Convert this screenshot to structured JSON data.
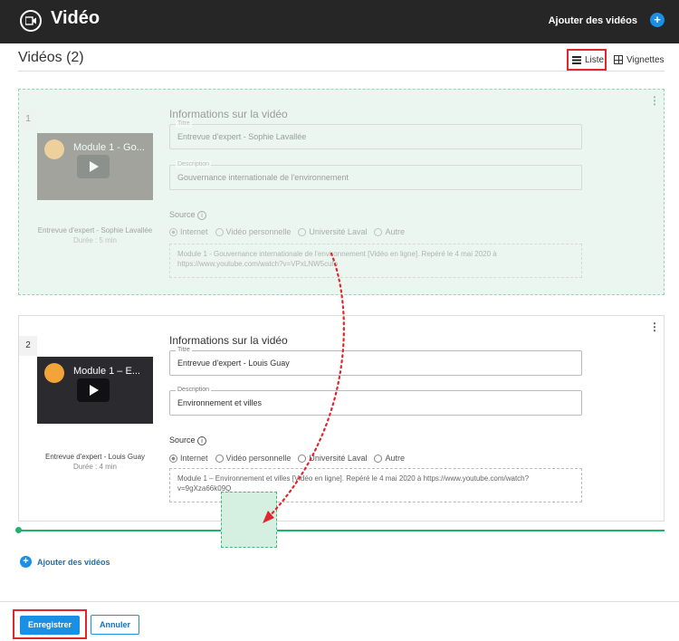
{
  "header": {
    "title": "Vidéo",
    "add_label": "Ajouter des vidéos"
  },
  "page": {
    "heading": "Vidéos (2)",
    "view_list": "Liste",
    "view_thumbs": "Vignettes"
  },
  "videos": [
    {
      "number": "1",
      "thumb_title": "Module 1 - Go...",
      "caption": "Entrevue d'expert - Sophie Lavallée",
      "duration": "Durée : 5 min",
      "info_heading": "Informations sur la vidéo",
      "title_label": "Titre",
      "title_value": "Entrevue d'expert - Sophie Lavallée",
      "desc_label": "Description",
      "desc_value": "Gouvernance internationale de l'environnement",
      "source_label": "Source",
      "sources": [
        "Internet",
        "Vidéo personnelle",
        "Université Laval",
        "Autre"
      ],
      "reference": "Module 1 - Gouvernance internationale de l'environnement [Vidéo en ligne]. Repéré le 4 mai 2020 à https://www.youtube.com/watch?v=VPxLNW5cufo"
    },
    {
      "number": "2",
      "thumb_title": "Module 1 – E...",
      "caption": "Entrevue d'expert - Louis Guay",
      "duration": "Durée : 4 min",
      "info_heading": "Informations sur la vidéo",
      "title_label": "Titre",
      "title_value": "Entrevue d'expert - Louis Guay",
      "desc_label": "Description",
      "desc_value": "Environnement et villes",
      "source_label": "Source",
      "sources": [
        "Internet",
        "Vidéo personnelle",
        "Université Laval",
        "Autre"
      ],
      "reference": "Module 1 – Environnement et villes [Vidéo en ligne]. Repéré le 4 mai 2020 à https://www.youtube.com/watch?v=9gXza66k09Q"
    }
  ],
  "footer": {
    "add_label": "Ajouter des vidéos",
    "save": "Enregistrer",
    "cancel": "Annuler"
  },
  "colors": {
    "accent": "#1a8fe6",
    "drop": "#1fb36b",
    "highlight": "#e0262e"
  }
}
